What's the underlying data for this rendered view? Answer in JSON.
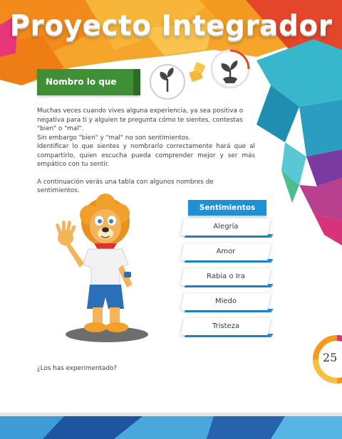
{
  "header": {
    "title": "Proyecto Integrador"
  },
  "section": {
    "banner": "Nombro lo que siento",
    "icons": [
      "sprout-icon",
      "puzzle-icon",
      "seedling-icon"
    ]
  },
  "body": {
    "paragraph_1": "Muchas veces cuando vives alguna experiencia, ya sea positiva o negativa para ti y alguien te pregunta cómo te sientes, contestas \"bien\" o \"mal\".",
    "paragraph_2": "Sin embargo \"bien\" y \"mal\" no son sentimientos.",
    "paragraph_3": "Identificar lo que sientes y nombrarlo correctamente hará que al compartirlo, quien escucha pueda comprender mejor y ser más empático con tu sentir.",
    "paragraph_4": "A continuación verás una tabla con algunos nombres de sentimientos."
  },
  "table": {
    "header": "Sentimientos",
    "items": [
      "Alegría",
      "Amor",
      "Rabia o Ira",
      "Miedo",
      "Tristeza"
    ]
  },
  "footer": {
    "question": "¿Los has experimentado?",
    "page_number": "25"
  },
  "colors": {
    "banner_green": "#3f8f36",
    "table_blue": "#1f8fd6",
    "orange": "#f39a1e",
    "teal": "#2bb3c9",
    "purple": "#8a3d9e",
    "magenta": "#d7337b"
  }
}
